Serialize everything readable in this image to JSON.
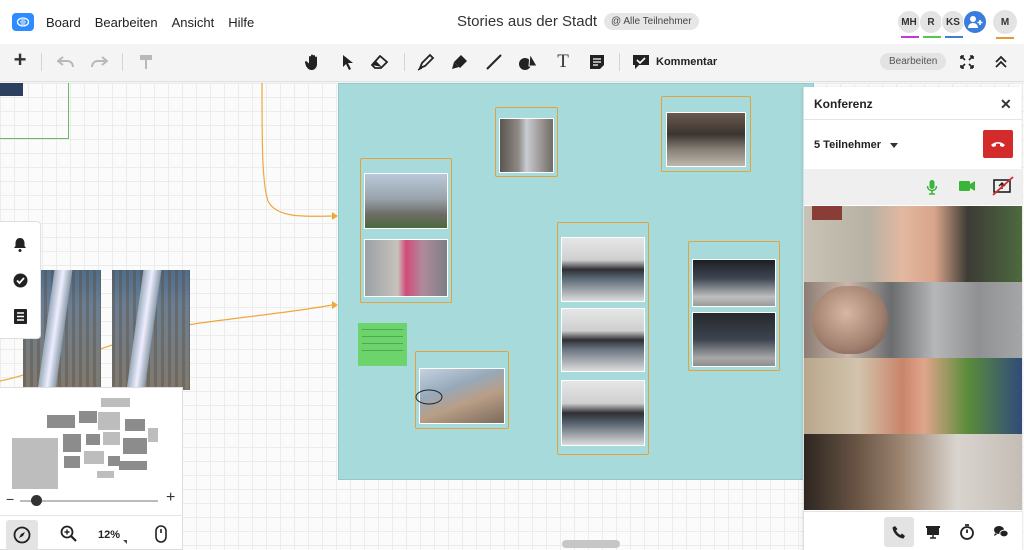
{
  "menubar": {
    "menu_items": [
      "Board",
      "Bearbeiten",
      "Ansicht",
      "Hilfe"
    ],
    "board_title": "Stories aus der Stadt",
    "audience_badge": "@ Alle Teilnehmer",
    "participants": [
      {
        "initials": "MH",
        "color": "#c03bd1"
      },
      {
        "initials": "R",
        "color": "#57c74d"
      },
      {
        "initials": "KS",
        "color": "#3b7ddd"
      }
    ],
    "current_user": {
      "initials": "M",
      "color": "#e39a2e"
    }
  },
  "toolbar": {
    "comment_label": "Kommentar",
    "edit_label": "Bearbeiten"
  },
  "minimap": {
    "zoom_percent": "12%",
    "zoom_level": 0.12
  },
  "conference": {
    "title": "Konferenz",
    "participant_count": "5 Teilnehmer"
  },
  "colors": {
    "board_background": "#a6dadb",
    "card_border": "#e5a13b",
    "connector": "#f0a73a",
    "hangup": "#d32b2b",
    "media_active": "#3ab53a"
  }
}
